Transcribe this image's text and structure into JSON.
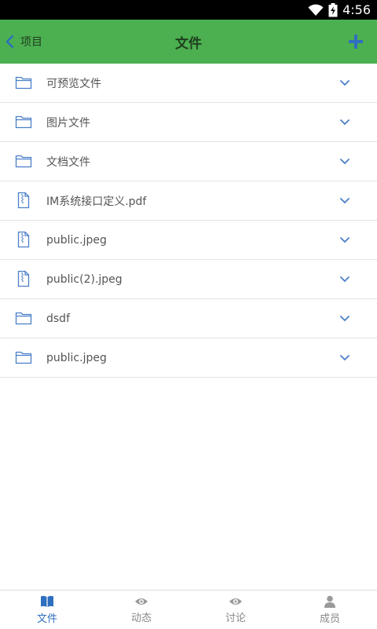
{
  "status_bar": {
    "time": "4:56"
  },
  "header": {
    "back_label": "项目",
    "title": "文件"
  },
  "files": [
    {
      "name": "可预览文件",
      "type": "folder"
    },
    {
      "name": "图片文件",
      "type": "folder"
    },
    {
      "name": "文档文件",
      "type": "folder"
    },
    {
      "name": "IM系统接口定义.pdf",
      "type": "file"
    },
    {
      "name": "public.jpeg",
      "type": "file"
    },
    {
      "name": "public(2).jpeg",
      "type": "file"
    },
    {
      "name": "dsdf",
      "type": "folder"
    },
    {
      "name": "public.jpeg",
      "type": "folder"
    }
  ],
  "tabs": [
    {
      "label": "文件",
      "icon": "book-icon",
      "active": true
    },
    {
      "label": "动态",
      "icon": "eye-icon",
      "active": false
    },
    {
      "label": "讨论",
      "icon": "eye-icon",
      "active": false
    },
    {
      "label": "成员",
      "icon": "person-icon",
      "active": false
    }
  ],
  "colors": {
    "header": "#4caf50",
    "accent": "#2f6fbf",
    "icon": "#4a7fc8"
  }
}
